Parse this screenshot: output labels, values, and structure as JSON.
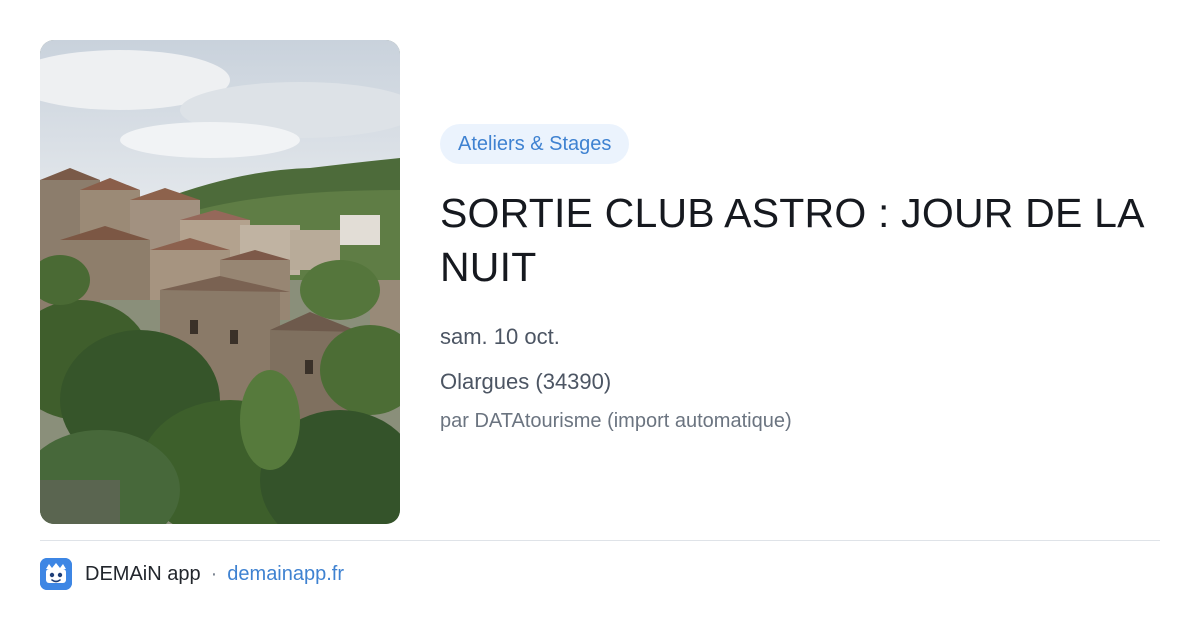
{
  "event": {
    "category": "Ateliers & Stages",
    "title": "SORTIE CLUB ASTRO : JOUR DE LA NUIT",
    "date": "sam. 10 oct.",
    "location": "Olargues (34390)",
    "source": "par DATAtourisme (import automatique)"
  },
  "footer": {
    "app_name": "DEMAiN app",
    "separator": "·",
    "link": "demainapp.fr"
  },
  "colors": {
    "accent": "#3f82d1",
    "tag_bg": "#ebf3fd",
    "title": "#16191f"
  }
}
